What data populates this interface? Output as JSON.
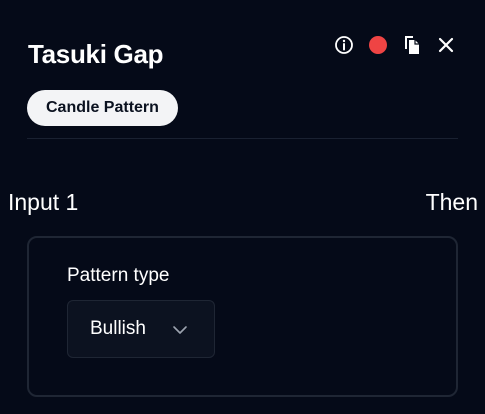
{
  "header": {
    "title": "Tasuki Gap",
    "actions": {
      "info_icon": "info-icon",
      "status_color": "#ef4444",
      "copy_icon": "copy-icon",
      "close_icon": "close-icon"
    }
  },
  "tag": {
    "label": "Candle Pattern"
  },
  "inputs": {
    "input_label": "Input 1",
    "then_label": "Then"
  },
  "pattern": {
    "field_label": "Pattern type",
    "selected_value": "Bullish",
    "chevron_icon": "chevron-down-icon"
  },
  "colors": {
    "background": "#050a18",
    "accent_red": "#ef4444",
    "tag_bg": "#f3f4f6"
  }
}
